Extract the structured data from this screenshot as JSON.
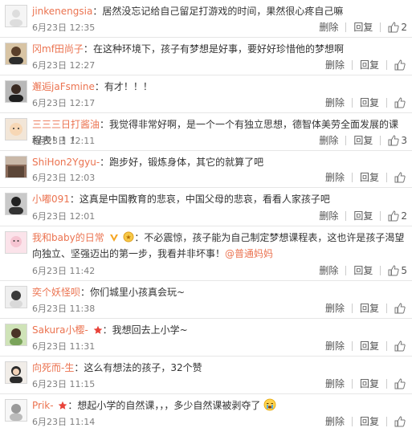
{
  "labels": {
    "delete": "删除",
    "reply": "回复"
  },
  "comments": [
    {
      "user": "jinkenengsia",
      "sep": "：",
      "text": "居然没忘记给自己留足打游戏的时间，果然很心疼自己嘛",
      "time": "6月23日 12:35",
      "likes": "2"
    },
    {
      "user": "冈mf田尚子",
      "sep": "：",
      "text": "在这种环境下，孩子有梦想是好事，要好好珍惜他的梦想啊",
      "time": "6月23日 12:27",
      "likes": ""
    },
    {
      "user": "邂逅jaFsmine",
      "sep": "：",
      "text": "有才！！！",
      "time": "6月23日 12:17",
      "likes": ""
    },
    {
      "user": "三三三日打酱油",
      "sep": "：",
      "text": "我觉得非常好啊，是一个一个有独立思想，德智体美劳全面发展的课程表！！！",
      "time": "6月23日 12:11",
      "likes": "3"
    },
    {
      "user": "ShiHon2Ygyu-",
      "sep": "：",
      "text": "跑步好，锻炼身体，其它的就算了吧",
      "time": "6月23日 12:03",
      "likes": ""
    },
    {
      "user": "小嘟091",
      "sep": "：",
      "text": "这真是中国教育的悲哀，中国父母的悲哀，看看人家孩子吧",
      "time": "6月23日 12:01",
      "likes": "2"
    },
    {
      "user": "我和baby的日常",
      "sep": "：",
      "text": "不必震惊，孩子能为自己制定梦想课程表，这也许是孩子渴望向独立、坚强迈出的第一步，我看并非坏事！",
      "mention": "@普通妈妈",
      "time": "6月23日 11:42",
      "likes": "5"
    },
    {
      "user": "奕个妖怪呗",
      "sep": "：",
      "text": "你们城里小孩真会玩~",
      "time": "6月23日 11:38",
      "likes": ""
    },
    {
      "user": "Sakura小樱-",
      "sep": "：",
      "text": "我想回去上小学~",
      "time": "6月23日 11:31",
      "likes": ""
    },
    {
      "user": "向死而-生",
      "sep": "：",
      "text": "这么有想法的孩子，32个赞",
      "time": "6月23日 11:15",
      "likes": ""
    },
    {
      "user": "Prik-",
      "sep": "：",
      "text": "想起小学的自然课，，，多少自然课被剥夺了",
      "time": "6月23日 11:14",
      "likes": ""
    }
  ],
  "colors": {
    "username": "#eb7350",
    "badge_star": "#e8433a",
    "vip": "#f5a623"
  }
}
